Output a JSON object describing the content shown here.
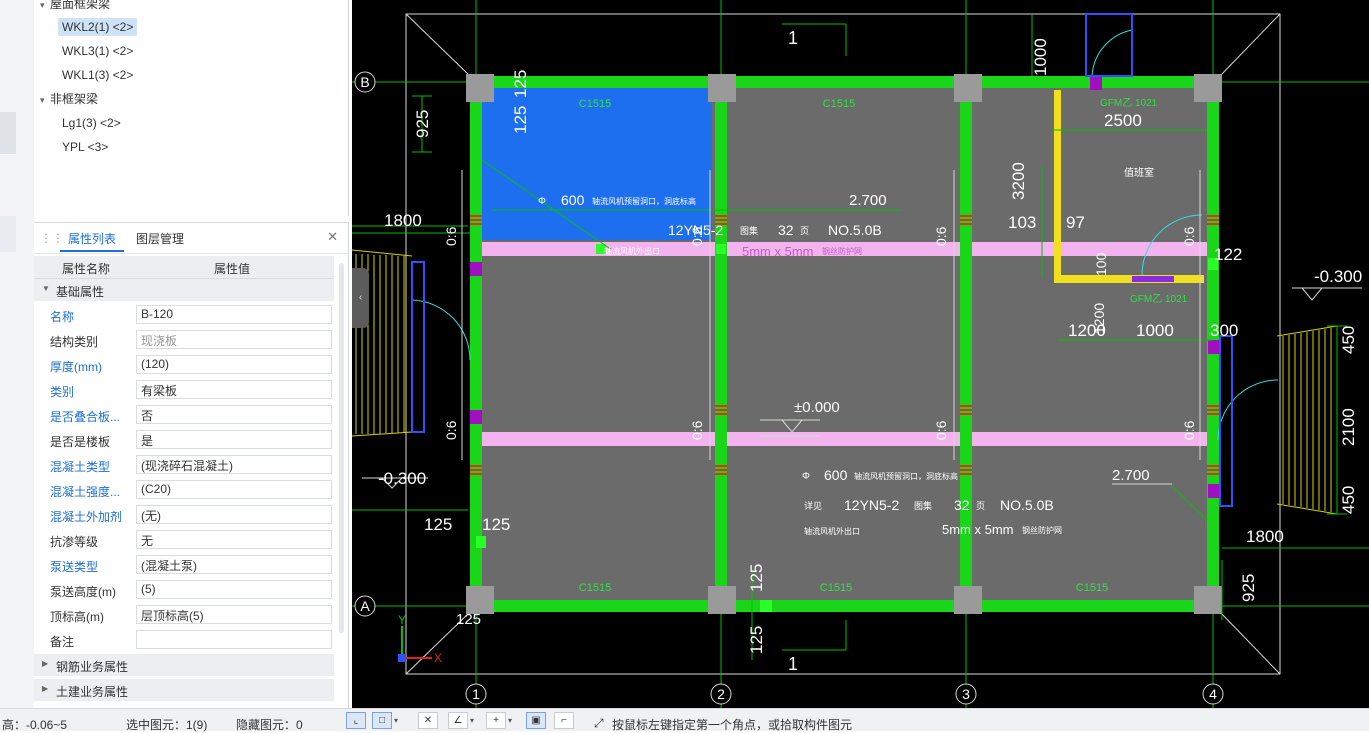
{
  "tree": {
    "group1": "屋面框架梁",
    "items1": [
      "WKL2(1) <2>",
      "WKL3(1) <2>",
      "WKL1(3) <2>"
    ],
    "group2": "非框架梁",
    "items2": [
      "Lg1(3) <2>",
      "YPL <3>"
    ]
  },
  "props_panel": {
    "tab_props": "属性列表",
    "tab_layers": "图层管理",
    "col_name": "属性名称",
    "col_value": "属性值",
    "group_basic": "基础属性",
    "rows": [
      {
        "name": "名称",
        "value": "B-120"
      },
      {
        "name": "结构类别",
        "value": "现浇板"
      },
      {
        "name": "厚度(mm)",
        "value": "(120)"
      },
      {
        "name": "类别",
        "value": "有梁板"
      },
      {
        "name": "是否叠合板...",
        "value": "否"
      },
      {
        "name": "是否是楼板",
        "value": "是"
      },
      {
        "name": "混凝土类型",
        "value": "(现浇碎石混凝土)"
      },
      {
        "name": "混凝土强度...",
        "value": "(C20)"
      },
      {
        "name": "混凝土外加剂",
        "value": "(无)"
      },
      {
        "name": "抗渗等级",
        "value": "无"
      },
      {
        "name": "泵送类型",
        "value": "(混凝土泵)"
      },
      {
        "name": "泵送高度(m)",
        "value": "(5)"
      },
      {
        "name": "顶标高(m)",
        "value": "层顶标高(5)"
      },
      {
        "name": "备注",
        "value": ""
      }
    ],
    "group_rebar": "钢筋业务属性",
    "group_civil": "土建业务属性"
  },
  "cad": {
    "axis_rows": [
      "B",
      "A"
    ],
    "axis_cols": [
      "1",
      "2",
      "3",
      "4"
    ],
    "beam_labels": [
      "C1515",
      "C1515",
      "C1515",
      "C1515",
      "C1515",
      "C1515"
    ],
    "dims": {
      "d125": "125",
      "d925": "925",
      "d1800": "1800",
      "d1000": "1000",
      "d2500": "2500",
      "d3200": "3200",
      "d103": "103",
      "d97": "97",
      "d122": "122",
      "d1200": "1200",
      "d300": "300",
      "d450": "450",
      "d2100": "2100",
      "d1": "1",
      "d100": "100"
    },
    "elev": {
      "e270": "2.700",
      "em030": "-0.300",
      "e000": "±0.000"
    },
    "ann": {
      "a600": "600",
      "phi": "Φ",
      "hole": "轴流风机预留洞口，洞底标高",
      "seeref": "详见",
      "atlas": "图集",
      "code": "12YN5-2",
      "n32": "32",
      "page": "页",
      "no": "NO.5.0B",
      "mesh": "5mm x 5mm",
      "meshnote": "钢丝防护网",
      "outlet": "轴流风机外出口",
      "duty": "值班室",
      "gfm": "GFM乙 1021",
      "dim06": "0:6",
      "note_12yn_a": "12YN5-2"
    }
  },
  "status": {
    "height": "高：-0.06~5",
    "selected": "选中图元：1(9)",
    "hidden": "隐藏图元：0",
    "hint": "按鼠标左键指定第一个角点，或拾取构件图元"
  }
}
